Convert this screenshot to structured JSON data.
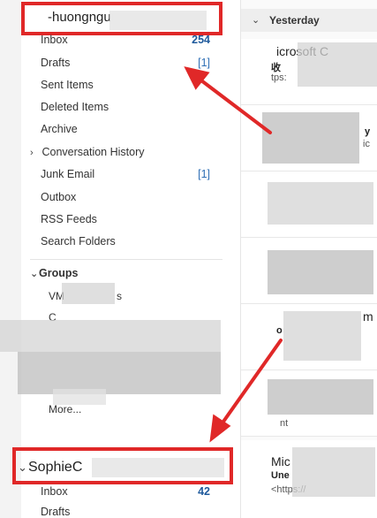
{
  "account1": {
    "name": "-huongngu"
  },
  "folders": [
    {
      "label": "Inbox",
      "count": "254",
      "bold": true
    },
    {
      "label": "Drafts",
      "count": "[1]"
    },
    {
      "label": "Sent Items",
      "count": ""
    },
    {
      "label": "Deleted Items",
      "count": ""
    },
    {
      "label": "Archive",
      "count": ""
    },
    {
      "label": "Conversation History",
      "count": "",
      "chevron": "›"
    },
    {
      "label": "Junk Email",
      "count": "[1]"
    },
    {
      "label": "Outbox",
      "count": ""
    },
    {
      "label": "RSS Feeds",
      "count": ""
    },
    {
      "label": "Search Folders",
      "count": ""
    }
  ],
  "groups": {
    "label": "Groups",
    "chevron": "⌄",
    "items": [
      "VM",
      "s",
      "C",
      "More..."
    ]
  },
  "account2": {
    "chevron": "⌄",
    "name": "SophieC",
    "inbox_label": "Inbox",
    "inbox_count": "42",
    "drafts_label": "Drafts"
  },
  "message_list": {
    "header_chevron": "⌄",
    "header": "Yesterday",
    "items": [
      {
        "sender": "icrosoft C",
        "line2": "收",
        "line3": "tps:"
      },
      {
        "sender": "",
        "line2": "y",
        "line3": "ic"
      },
      {
        "sender": "",
        "line2": "",
        "line3": ""
      },
      {
        "sender": "",
        "line2": "",
        "line3": ""
      },
      {
        "sender": "m",
        "line2": "o",
        "line3": ""
      },
      {
        "sender": "",
        "line2": "",
        "line3": "nt"
      },
      {
        "sender": "Mic",
        "line2": "Une",
        "line3": "<https://"
      }
    ]
  },
  "colors": {
    "annotation_red": "#e02828",
    "link_blue": "#2f6fb5"
  }
}
